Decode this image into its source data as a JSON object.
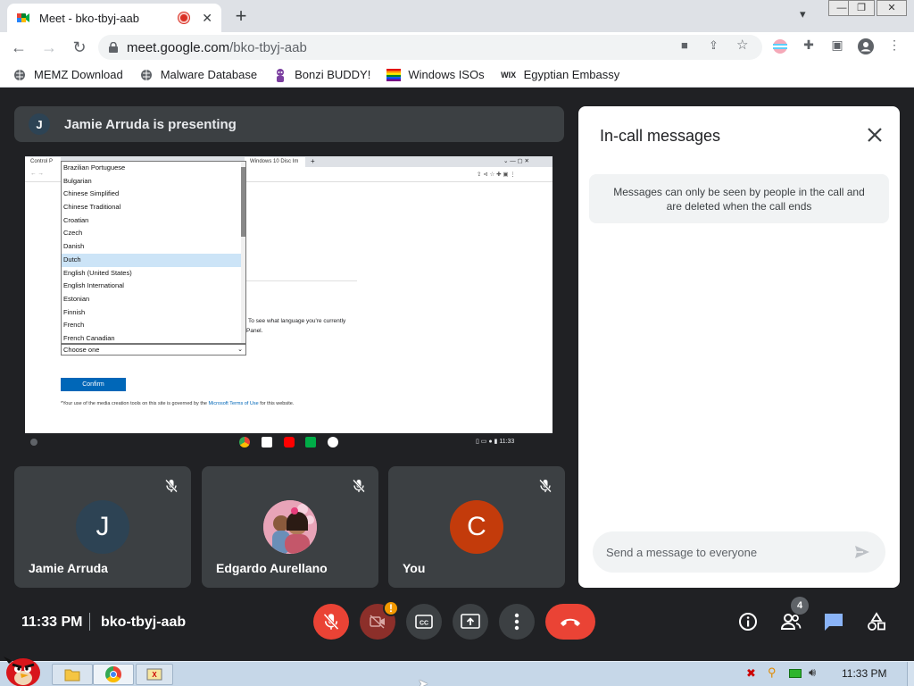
{
  "browser": {
    "tab_title": "Meet - bko-tbyj-aab",
    "url_host": "meet.google.com",
    "url_path": "/bko-tbyj-aab",
    "bookmarks": [
      {
        "label": "MEMZ Download",
        "icon": "globe-icon"
      },
      {
        "label": "Malware Database",
        "icon": "globe-icon"
      },
      {
        "label": "Bonzi BUDDY!",
        "icon": "bonzi-icon"
      },
      {
        "label": "Windows ISOs",
        "icon": "rainbow-flag-icon"
      },
      {
        "label": "Egyptian Embassy",
        "icon": "wix-icon"
      }
    ],
    "wix_text": "WIX"
  },
  "presentation": {
    "banner_initial": "J",
    "banner_text": "Jamie Arruda is presenting",
    "shared_tab_1": "Control P",
    "shared_tab_2": "Windows 10 Disc Im",
    "languages": [
      "Brazilian Portuguese",
      "Bulgarian",
      "Chinese Simplified",
      "Chinese Traditional",
      "Croatian",
      "Czech",
      "Danish",
      "Dutch",
      "English (United States)",
      "English International",
      "Estonian",
      "Finnish",
      "French",
      "French Canadian"
    ],
    "selected_language": "Dutch",
    "select_value": "Choose one",
    "body_text_1": "To see what language you're currently",
    "body_text_2": "Panel.",
    "confirm_label": "Confirm",
    "footer_prefix": "*Your use of the media creation tools on this site is governed by the",
    "footer_link": "Microsoft Terms of Use",
    "footer_suffix": "for this website.",
    "shelf_time": "11:33"
  },
  "participants": [
    {
      "name": "Jamie Arruda",
      "initial": "J",
      "avatar_color": "#2d4354"
    },
    {
      "name": "Edgardo Aurellano",
      "initial": "",
      "avatar_color": "#c2707f"
    },
    {
      "name": "You",
      "initial": "C",
      "avatar_color": "#c33b0b"
    }
  ],
  "messages_panel": {
    "title": "In-call messages",
    "note": "Messages can only be seen by people in the call and are deleted when the call ends",
    "input_placeholder": "Send a message to everyone"
  },
  "controls": {
    "time": "11:33 PM",
    "meeting_code": "bko-tbyj-aab",
    "camera_warning": "!",
    "people_count": "4",
    "colors": {
      "red": "#ea4335",
      "dark": "#3c4043",
      "accent": "#8ab4f8"
    }
  },
  "taskbar": {
    "time": "11:33 PM"
  }
}
